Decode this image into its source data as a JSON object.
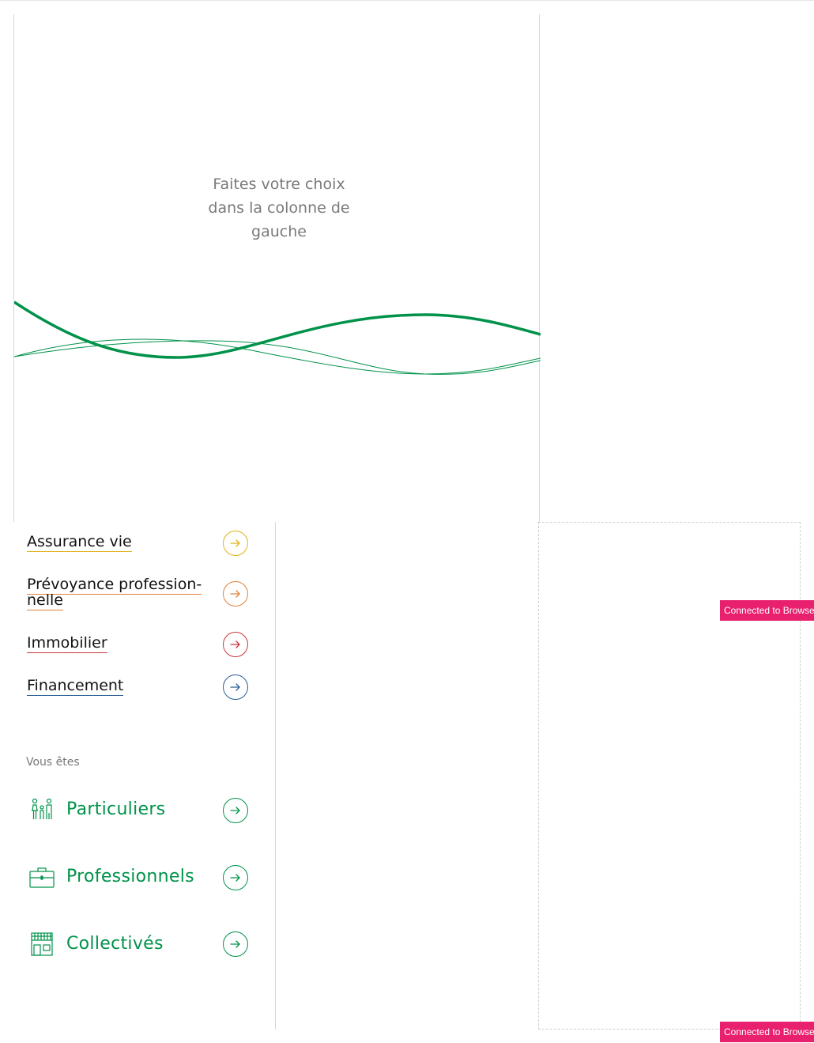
{
  "placeholder": {
    "line1": "Faites votre choix",
    "line2": "dans la colonne de",
    "line3": "gauche"
  },
  "products": [
    {
      "label": "Assurance vie",
      "color": "#e0b21c",
      "icon": "arrow-right-icon"
    },
    {
      "label": "Prévoyance profession-",
      "label2": "nelle",
      "color": "#e0823a",
      "icon": "arrow-right-icon"
    },
    {
      "label": "Immobilier",
      "color": "#c9363b",
      "icon": "arrow-right-icon"
    },
    {
      "label": "Financement",
      "color": "#2a5f95",
      "icon": "arrow-right-icon"
    }
  ],
  "segments_heading": "Vous êtes",
  "segments": [
    {
      "label": "Particuliers",
      "icon": "family-icon"
    },
    {
      "label": "Professionnels",
      "icon": "briefcase-icon"
    },
    {
      "label": "Collectivés",
      "icon": "building-icon"
    }
  ],
  "brand_color": "#00924a",
  "badge_text": "Connected to Browse"
}
